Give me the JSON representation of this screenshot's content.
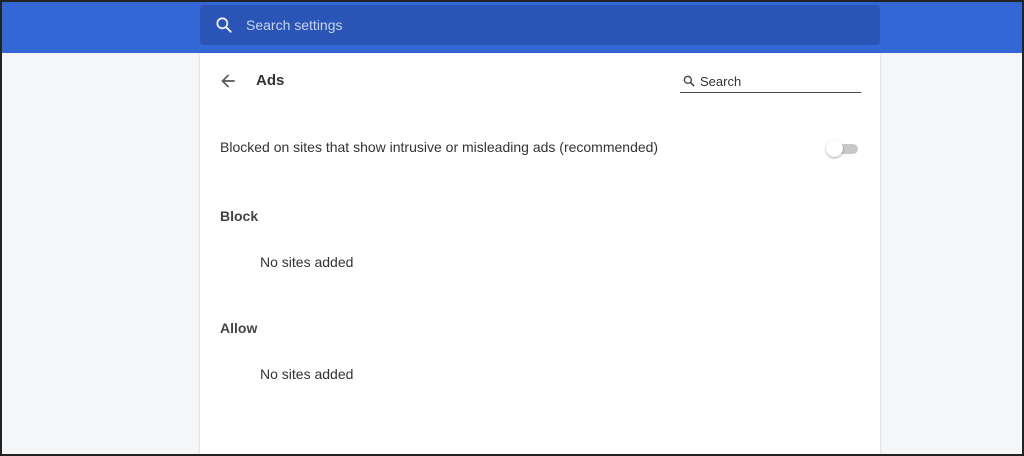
{
  "top_search": {
    "placeholder": "Search settings"
  },
  "page": {
    "title": "Ads"
  },
  "sub_search": {
    "label": "Search"
  },
  "setting": {
    "label": "Blocked on sites that show intrusive or misleading ads (recommended)",
    "toggle_on": false
  },
  "sections": [
    {
      "heading": "Block",
      "empty_text": "No sites added"
    },
    {
      "heading": "Allow",
      "empty_text": "No sites added"
    }
  ],
  "colors": {
    "topbar": "#3367d6",
    "search_box": "#2a55b6",
    "card": "#ffffff",
    "background": "#f5f6f7"
  },
  "icons": {
    "top_search": "search-icon",
    "back": "arrow-back-icon",
    "sub_search": "search-icon"
  }
}
